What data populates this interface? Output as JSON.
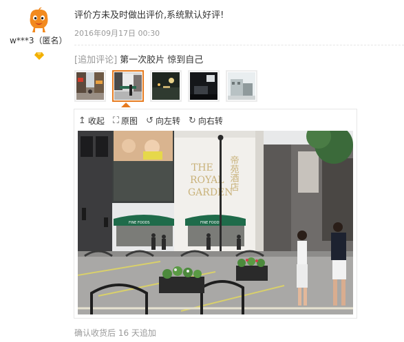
{
  "user": {
    "name": "w***3（匿名）",
    "avatar_icon": "orange-mascot-avatar",
    "level_icon": "gold-diamond-icon"
  },
  "review": {
    "text": "评价方未及时做出评价,系统默认好评!",
    "date": "2016年09月17日 00:30"
  },
  "append": {
    "tag": "[追加评论]",
    "text": "第一次胶片 惊到自己"
  },
  "thumbnails": [
    {
      "name": "street-scene",
      "active": false
    },
    {
      "name": "storefront",
      "active": true
    },
    {
      "name": "night-street",
      "active": false
    },
    {
      "name": "dark-room",
      "active": false
    },
    {
      "name": "building",
      "active": false
    }
  ],
  "toolbar": {
    "collapse": "收起",
    "collapse_icon": "arrow-up-icon",
    "original": "原图",
    "original_icon": "expand-icon",
    "rotate_left": "向左转",
    "rotate_left_icon": "rotate-left-icon",
    "rotate_right": "向右转",
    "rotate_right_icon": "rotate-right-icon"
  },
  "photo": {
    "sign_line1": "THE",
    "sign_line2": "ROYAL",
    "sign_line3": "GARDEN",
    "sign_cn": "帝苑酒店",
    "shop_left": "FINE FOODS",
    "shop_right": "FINE FOODS"
  },
  "footer": {
    "text": "确认收货后 16 天追加"
  },
  "colors": {
    "accent": "#e67a1e",
    "muted": "#999999",
    "text": "#333333",
    "awning_green": "#1f6b4a"
  }
}
